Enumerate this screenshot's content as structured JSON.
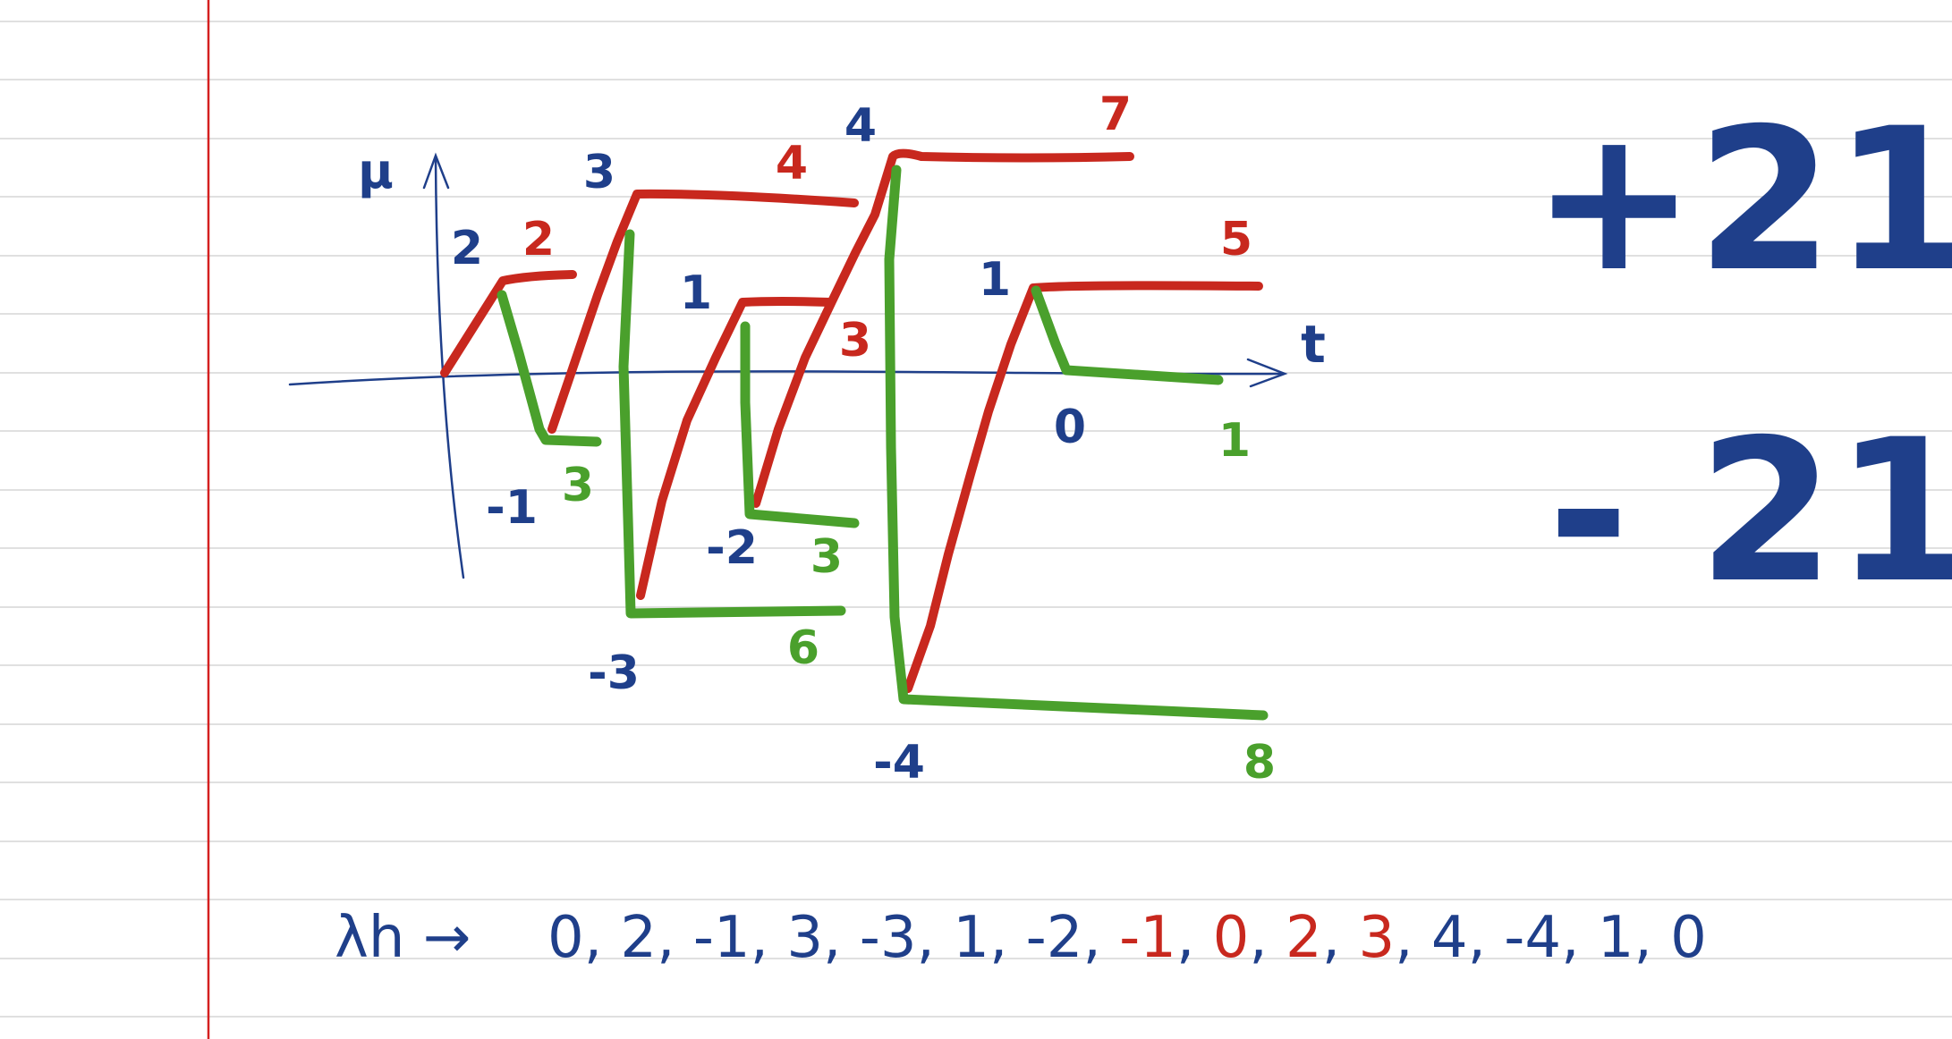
{
  "axes": {
    "y_label": "μ",
    "x_label": "t"
  },
  "red_labels": [
    "2",
    "4",
    "7",
    "5",
    "3"
  ],
  "blue_labels": [
    "2",
    "3",
    "4",
    "1",
    "1",
    "-1",
    "-2",
    "-3",
    "-4",
    "0"
  ],
  "green_labels": [
    "3",
    "3",
    "6",
    "8",
    "1"
  ],
  "totals": {
    "plus": "+21",
    "minus": "- 21"
  },
  "sequence": {
    "prefix": "λh →",
    "items": [
      {
        "text": "0",
        "color": "#1f3f8a"
      },
      {
        "text": "2",
        "color": "#1f3f8a"
      },
      {
        "text": "-1",
        "color": "#1f3f8a"
      },
      {
        "text": "3",
        "color": "#1f3f8a"
      },
      {
        "text": "-3",
        "color": "#1f3f8a"
      },
      {
        "text": "1",
        "color": "#1f3f8a"
      },
      {
        "text": "-2",
        "color": "#1f3f8a"
      },
      {
        "text": "-1",
        "color": "#c8281e"
      },
      {
        "text": "0",
        "color": "#c8281e"
      },
      {
        "text": "2",
        "color": "#c8281e"
      },
      {
        "text": "3",
        "color": "#c8281e"
      },
      {
        "text": "4",
        "color": "#1f3f8a"
      },
      {
        "text": "-4",
        "color": "#1f3f8a"
      },
      {
        "text": "1",
        "color": "#1f3f8a"
      },
      {
        "text": "0",
        "color": "#1f3f8a"
      }
    ]
  },
  "colors": {
    "red": "#c8281e",
    "green": "#4aa02c",
    "blue": "#1f3f8a",
    "margin": "#d42020",
    "rule": "#d6d6d6"
  }
}
